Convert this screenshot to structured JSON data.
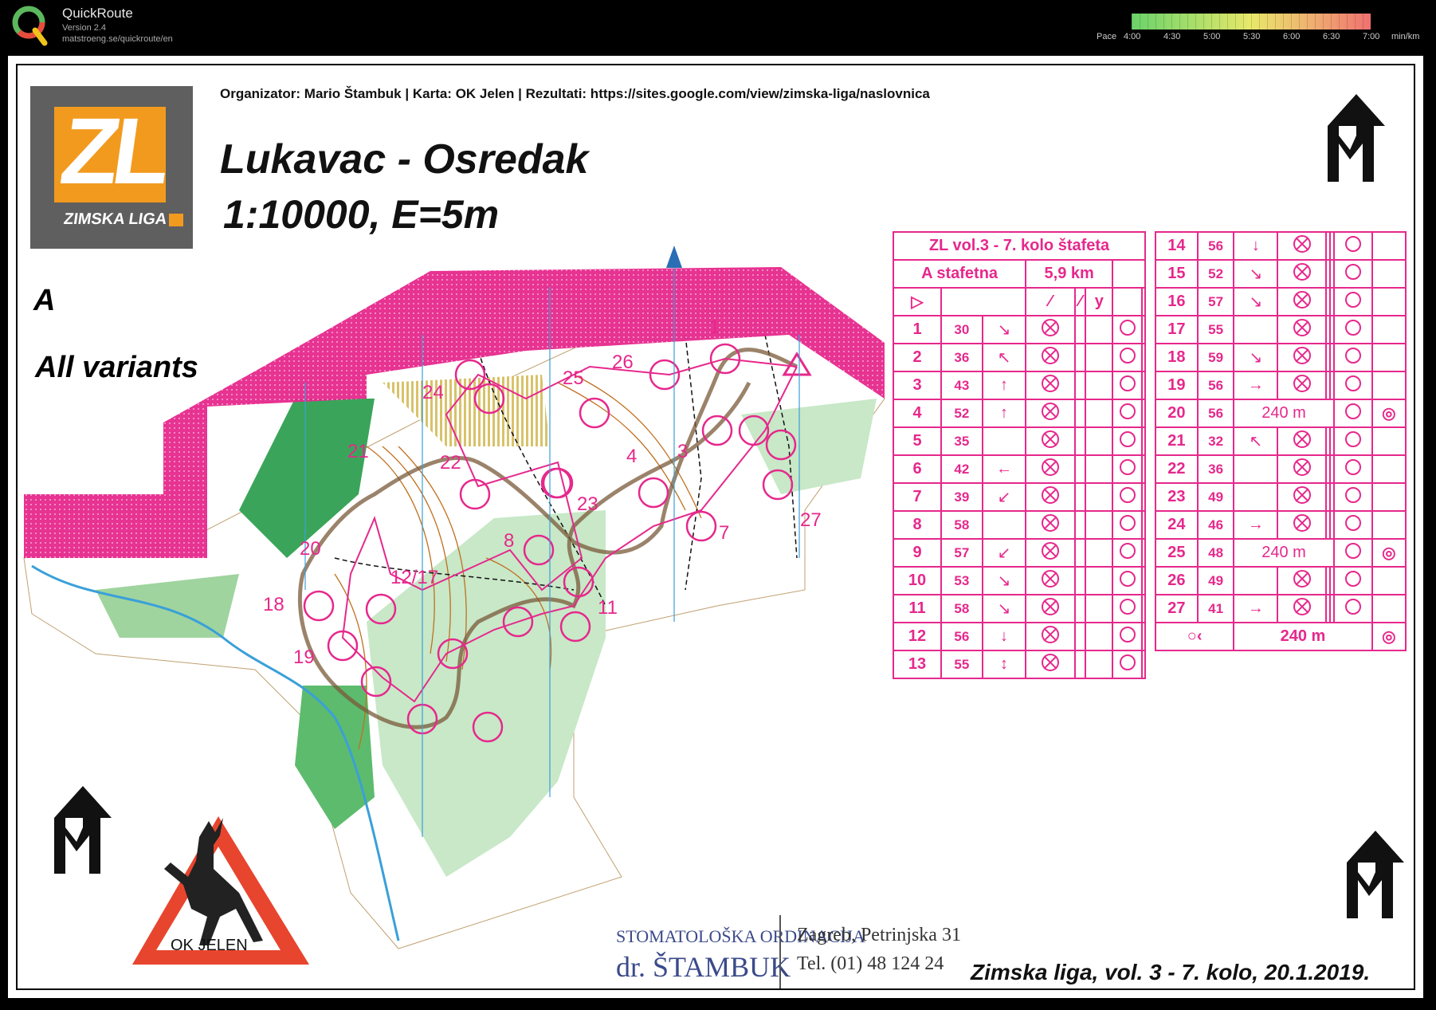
{
  "app": {
    "name": "QuickRoute",
    "version": "Version 2.4",
    "url": "matstroeng.se/quickroute/en"
  },
  "pace_scale": {
    "label": "Pace",
    "ticks": [
      "4:00",
      "4:30",
      "5:00",
      "5:30",
      "6:00",
      "6:30",
      "7:00"
    ],
    "unit": "min/km",
    "colors": [
      "#6ad36a",
      "#a6de6a",
      "#e8e86a",
      "#f0b070",
      "#f07070"
    ]
  },
  "header": {
    "organizer": "Organizator: Mario Štambuk | Karta: OK Jelen | Rezultati: https://sites.google.com/view/zimska-liga/naslovnica",
    "title": "Lukavac - Osredak",
    "scale": "1:10000, E=5m",
    "logo_letters": "ZL",
    "logo_caption": "ZIMSKA LIGA"
  },
  "variant": {
    "letter": "A",
    "label": "All variants"
  },
  "colors": {
    "course": "#e6288c",
    "forbidden": "#e6288c",
    "forest": "#9fd49f",
    "open": "#f5d76e",
    "water": "#3aa0d8"
  },
  "control_labels": [
    {
      "n": "1"
    },
    {
      "n": "3"
    },
    {
      "n": "4"
    },
    {
      "n": "7"
    },
    {
      "n": "8"
    },
    {
      "n": "11"
    },
    {
      "n": "12/17"
    },
    {
      "n": "18"
    },
    {
      "n": "19"
    },
    {
      "n": "20"
    },
    {
      "n": "21"
    },
    {
      "n": "22"
    },
    {
      "n": "23"
    },
    {
      "n": "24"
    },
    {
      "n": "25"
    },
    {
      "n": "26"
    },
    {
      "n": "27"
    }
  ],
  "descriptions": {
    "heading": "ZL vol.3 - 7. kolo štafeta",
    "class": "A stafetna",
    "length": "5,9 km",
    "left_rows": [
      {
        "n": "1",
        "code": "30",
        "dir": "↘"
      },
      {
        "n": "2",
        "code": "36",
        "dir": "↖"
      },
      {
        "n": "3",
        "code": "43",
        "dir": "↑"
      },
      {
        "n": "4",
        "code": "52",
        "dir": "↑"
      },
      {
        "n": "5",
        "code": "35",
        "dir": ""
      },
      {
        "n": "6",
        "code": "42",
        "dir": "←"
      },
      {
        "n": "7",
        "code": "39",
        "dir": "↙"
      },
      {
        "n": "8",
        "code": "58",
        "dir": ""
      },
      {
        "n": "9",
        "code": "57",
        "dir": "↙"
      },
      {
        "n": "10",
        "code": "53",
        "dir": "↘"
      },
      {
        "n": "11",
        "code": "58",
        "dir": "↘"
      },
      {
        "n": "12",
        "code": "56",
        "dir": "↓"
      },
      {
        "n": "13",
        "code": "55",
        "dir": "↕"
      }
    ],
    "right_rows": [
      {
        "n": "14",
        "code": "56",
        "dir": "↓"
      },
      {
        "n": "15",
        "code": "52",
        "dir": "↘"
      },
      {
        "n": "16",
        "code": "57",
        "dir": "↘"
      },
      {
        "n": "17",
        "code": "55",
        "dir": ""
      },
      {
        "n": "18",
        "code": "59",
        "dir": "↘"
      },
      {
        "n": "19",
        "code": "56",
        "dir": "→"
      },
      {
        "n": "20",
        "code": "56",
        "dir": "240 m"
      },
      {
        "n": "21",
        "code": "32",
        "dir": "↖"
      },
      {
        "n": "22",
        "code": "36",
        "dir": ""
      },
      {
        "n": "23",
        "code": "49",
        "dir": ""
      },
      {
        "n": "24",
        "code": "46",
        "dir": "→"
      },
      {
        "n": "25",
        "code": "48",
        "dir": "240 m"
      },
      {
        "n": "26",
        "code": "49",
        "dir": ""
      },
      {
        "n": "27",
        "code": "41",
        "dir": "→"
      }
    ],
    "finish": "240 m"
  },
  "footer": {
    "sponsor_line1": "STOMATOLOŠKA ORDINACIJA",
    "sponsor_line2": "dr. ŠTAMBUK",
    "address": "Zagreb, Petrinjska 31",
    "phone": "Tel. (01) 48 124 24",
    "club": "OK JELEN",
    "event": "Zimska liga, vol. 3 - 7. kolo, 20.1.2019."
  }
}
